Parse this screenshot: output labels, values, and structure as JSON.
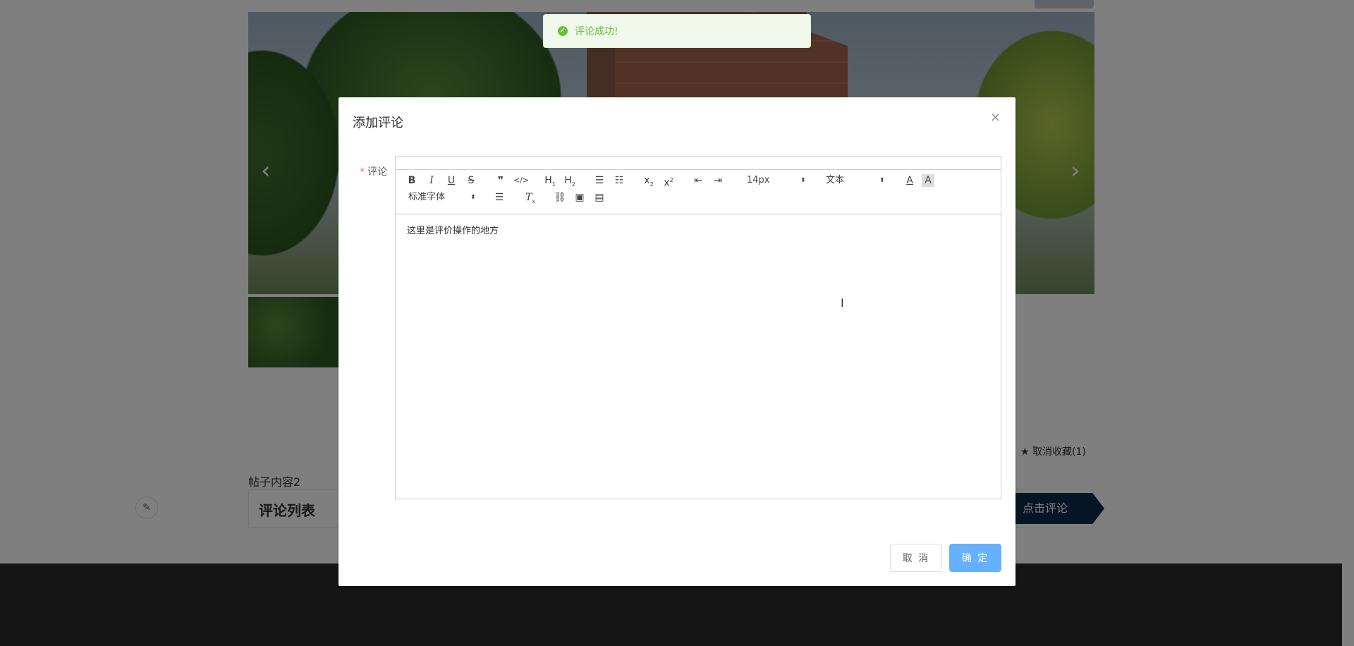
{
  "toast": {
    "message": "评论成功!"
  },
  "page": {
    "favorite_label": "取消收藏(1)",
    "post_content": "帖子内容2",
    "comment_list_title": "评论列表",
    "click_comment_label": "点击评论"
  },
  "dialog": {
    "title": "添加评论",
    "close_icon": "×",
    "comment_label": "评论",
    "required_mark": "*",
    "editor": {
      "font_size": "14px",
      "header": "文本",
      "font_family": "标准字体",
      "content": "这里是评价操作的地方"
    },
    "cancel_label": "取 消",
    "confirm_label": "确 定"
  },
  "colors": {
    "primary_light": "#66b1ff",
    "success": "#67c23a",
    "danger": "#f56c6c",
    "footer": "#2b2b2b"
  }
}
